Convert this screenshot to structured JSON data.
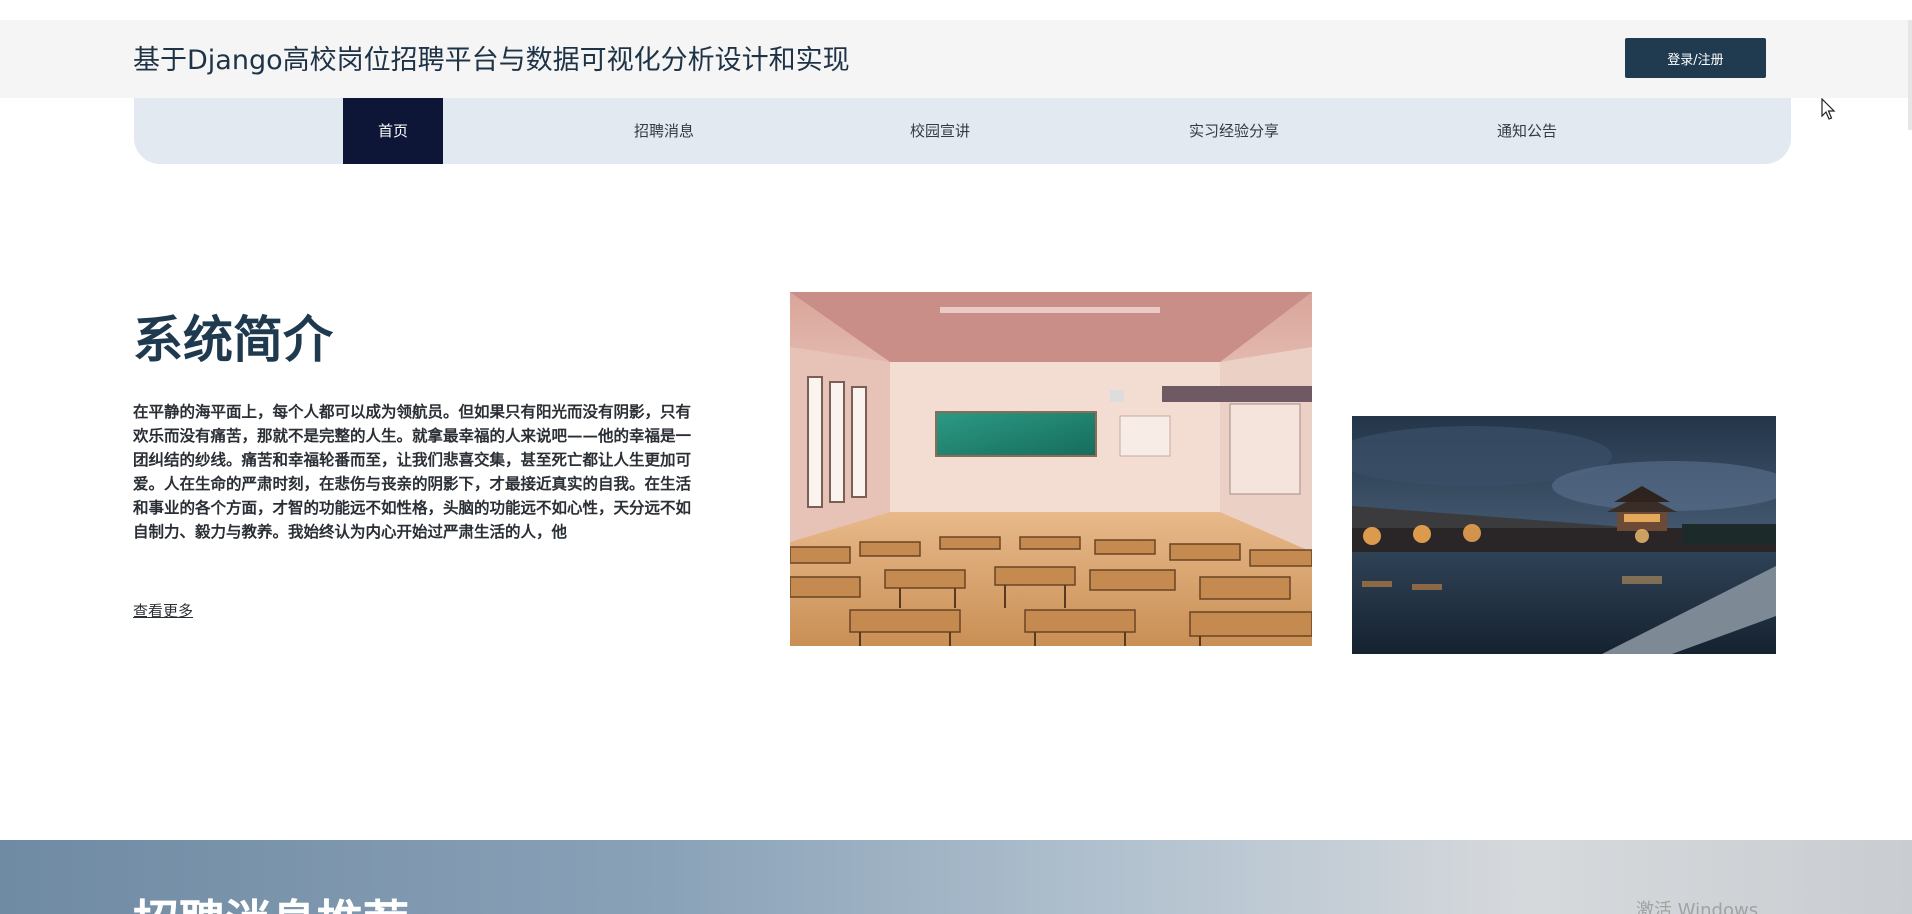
{
  "header": {
    "site_title": "基于Django高校岗位招聘平台与数据可视化分析设计和实现",
    "login_label": "登录/注册"
  },
  "nav": {
    "items": [
      {
        "label": "首页",
        "active": true
      },
      {
        "label": "招聘消息",
        "active": false
      },
      {
        "label": "校园宣讲",
        "active": false
      },
      {
        "label": "实习经验分享",
        "active": false
      },
      {
        "label": "通知公告",
        "active": false
      }
    ]
  },
  "intro": {
    "title": "系统简介",
    "text": "在平静的海平面上，每个人都可以成为领航员。但如果只有阳光而没有阴影，只有欢乐而没有痛苦，那就不是完整的人生。就拿最幸福的人来说吧——他的幸福是一团纠结的纱线。痛苦和幸福轮番而至，让我们悲喜交集，甚至死亡都让人生更加可爱。人在生命的严肃时刻，在悲伤与丧亲的阴影下，才最接近真实的自我。在生活和事业的各个方面，才智的功能远不如性格，头脑的功能远不如心性，天分远不如自制力、毅力与教养。我始终认为内心开始过严肃生活的人，他",
    "view_more": "查看更多"
  },
  "section": {
    "heading": "招聘消息推荐"
  },
  "watermark": {
    "text": "激活 Windows"
  },
  "colors": {
    "header_bg": "#f5f5f5",
    "nav_bg": "#e3e9f1",
    "nav_active_bg": "#0d1637",
    "login_bg": "#203a4f",
    "title_color": "#1f3a4f"
  }
}
